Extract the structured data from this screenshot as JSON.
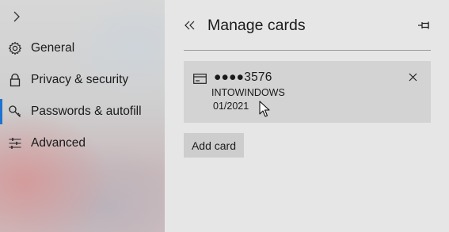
{
  "sidebar": {
    "expand_icon": "chevron-right-icon",
    "items": [
      {
        "label": "General",
        "icon": "gear-icon",
        "selected": false
      },
      {
        "label": "Privacy & security",
        "icon": "lock-icon",
        "selected": false
      },
      {
        "label": "Passwords & autofill",
        "icon": "key-icon",
        "selected": true
      },
      {
        "label": "Advanced",
        "icon": "sliders-icon",
        "selected": false
      }
    ],
    "accent_color": "#1e73d0"
  },
  "panel": {
    "title": "Manage cards",
    "back_icon": "double-chevron-left-icon",
    "pin_icon": "pin-icon",
    "cards": [
      {
        "number": "●●●●3576",
        "name": "INTOWINDOWS",
        "expiry": "01/2021",
        "icon": "credit-card-icon",
        "remove_icon": "close-icon"
      }
    ],
    "add_card_label": "Add card"
  }
}
